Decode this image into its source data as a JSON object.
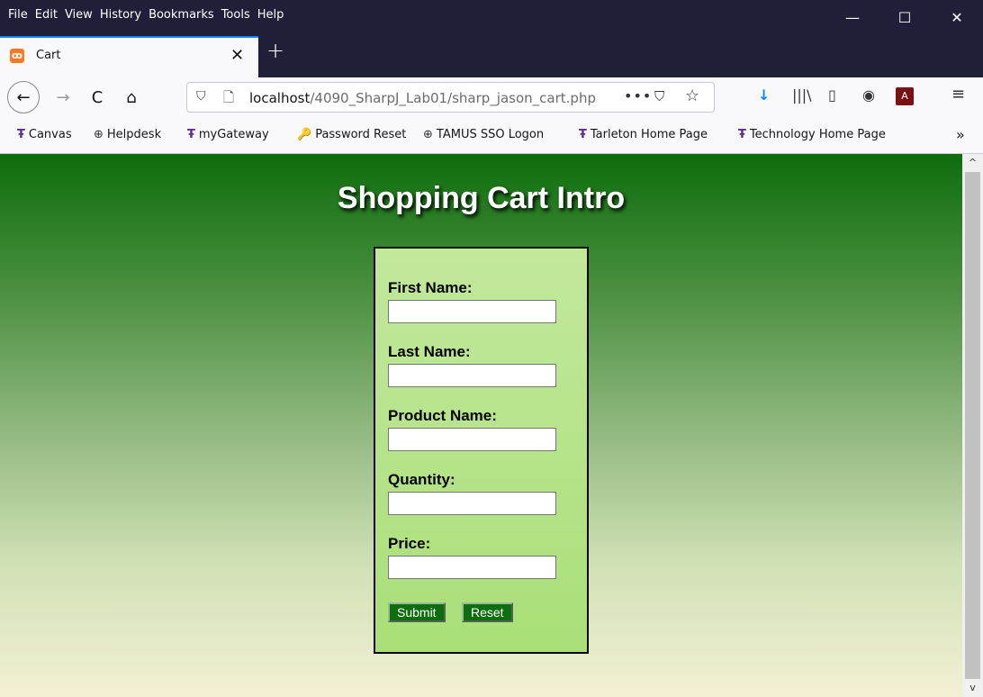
{
  "menu": [
    "File",
    "Edit",
    "View",
    "History",
    "Bookmarks",
    "Tools",
    "Help"
  ],
  "window_controls": {
    "minimize": "—",
    "maximize": "☐",
    "close": "✕"
  },
  "tab": {
    "favicon": "xampp-icon",
    "title": "Cart",
    "close": "✕"
  },
  "newtab": "+",
  "nav": {
    "back": "←",
    "forward": "→",
    "reload": "C",
    "home": "⌂",
    "url_host": "localhost",
    "url_path": "/4090_SharpJ_Lab01/sharp_jason_cart.php",
    "page_actions": "•••",
    "pocket": "☐",
    "bookmark_star": "☆"
  },
  "toolbar_icons": {
    "download": "↓",
    "library": "|||\\",
    "sidebar": "▯",
    "account": "◉",
    "pdf": "A",
    "menu": "≡"
  },
  "bookmarks": [
    {
      "icon": "tarleton-icon",
      "label": "Canvas"
    },
    {
      "icon": "globe-icon",
      "label": "Helpdesk"
    },
    {
      "icon": "tarleton-icon",
      "label": "myGateway"
    },
    {
      "icon": "key-icon",
      "label": "Password Reset"
    },
    {
      "icon": "globe-icon",
      "label": "TAMUS SSO Logon"
    },
    {
      "icon": "tarleton-icon",
      "label": "Tarleton Home Page"
    },
    {
      "icon": "tarleton-icon",
      "label": "Technology Home Page"
    }
  ],
  "bookmarks_more": "»",
  "page": {
    "title": "Shopping Cart Intro",
    "fields": [
      {
        "label": "First Name:",
        "value": ""
      },
      {
        "label": "Last Name:",
        "value": ""
      },
      {
        "label": "Product Name:",
        "value": ""
      },
      {
        "label": "Quantity:",
        "value": ""
      },
      {
        "label": "Price:",
        "value": ""
      }
    ],
    "submit_label": "Submit",
    "reset_label": "Reset"
  },
  "colors": {
    "page_gradient_top": "#0e6d0e",
    "page_gradient_bottom": "#f3f0d4",
    "form_bg": "#b4e48a",
    "button_bg": "#0e6d0e"
  }
}
